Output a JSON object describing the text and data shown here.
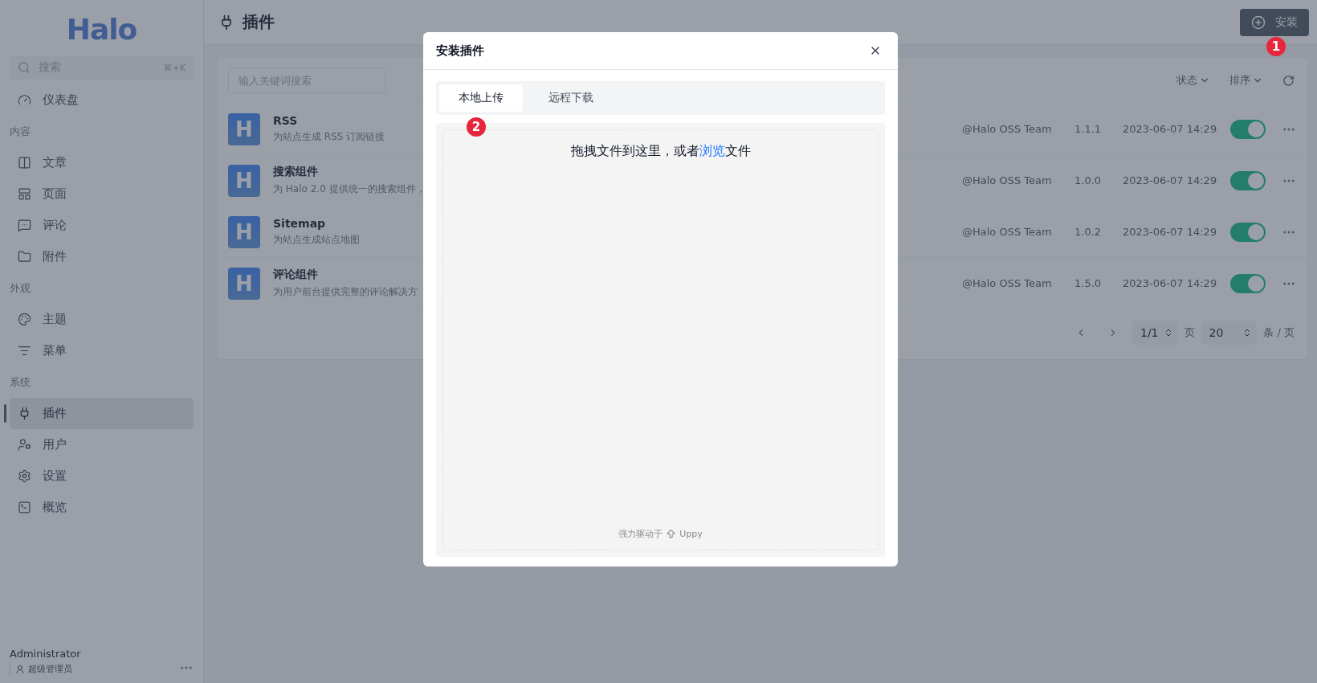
{
  "sidebar": {
    "logo": "Halo",
    "search": {
      "placeholder": "搜索",
      "shortcut": "⌘+K"
    },
    "items": [
      {
        "kind": "item",
        "label": "仪表盘",
        "selected": false
      },
      {
        "kind": "heading",
        "label": "内容"
      },
      {
        "kind": "item",
        "label": "文章",
        "selected": false
      },
      {
        "kind": "item",
        "label": "页面",
        "selected": false
      },
      {
        "kind": "item",
        "label": "评论",
        "selected": false
      },
      {
        "kind": "item",
        "label": "附件",
        "selected": false
      },
      {
        "kind": "heading",
        "label": "外观"
      },
      {
        "kind": "item",
        "label": "主题",
        "selected": false
      },
      {
        "kind": "item",
        "label": "菜单",
        "selected": false
      },
      {
        "kind": "heading",
        "label": "系统"
      },
      {
        "kind": "item",
        "label": "插件",
        "selected": true
      },
      {
        "kind": "item",
        "label": "用户",
        "selected": false
      },
      {
        "kind": "item",
        "label": "设置",
        "selected": false
      },
      {
        "kind": "item",
        "label": "概览",
        "selected": false
      }
    ],
    "user": {
      "name": "Administrator",
      "role": "超级管理员"
    }
  },
  "header": {
    "title": "插件",
    "install_button": "安装"
  },
  "plugins": {
    "search": {
      "placeholder": "输入关键词搜索"
    },
    "filters": [
      "状态",
      "排序"
    ],
    "rows": [
      {
        "logo": "H",
        "name": "RSS",
        "description": "为站点生成 RSS 订阅链接",
        "author": "@Halo OSS Team",
        "version": "1.1.1",
        "time": "2023-06-07 14:29",
        "enabled": true
      },
      {
        "logo": "H",
        "name": "搜索组件",
        "description": "为 Halo 2.0 提供统一的搜索组件，",
        "author": "@Halo OSS Team",
        "version": "1.0.0",
        "time": "2023-06-07 14:29",
        "enabled": true
      },
      {
        "logo": "H",
        "name": "Sitemap",
        "description": "为站点生成站点地图",
        "author": "@Halo OSS Team",
        "version": "1.0.2",
        "time": "2023-06-07 14:29",
        "enabled": true
      },
      {
        "logo": "H",
        "name": "评论组件",
        "description": "为用户前台提供完整的评论解决方",
        "author": "@Halo OSS Team",
        "version": "1.5.0",
        "time": "2023-06-07 14:29",
        "enabled": true
      }
    ],
    "pagination": {
      "page": "1/1",
      "page_unit": "页",
      "size": "20",
      "size_unit": "条 / 页"
    }
  },
  "dialog": {
    "title": "安装插件",
    "tabs": [
      {
        "label": "本地上传",
        "selected": true
      },
      {
        "label": "远程下载",
        "selected": false
      }
    ],
    "drop_hint_before": "拖拽文件到这里，或者",
    "browse_link": "浏览",
    "drop_hint_after": "文件",
    "powered_by": "强力驱动于",
    "brand": "Uppy"
  },
  "annotations": [
    "1",
    "2"
  ]
}
